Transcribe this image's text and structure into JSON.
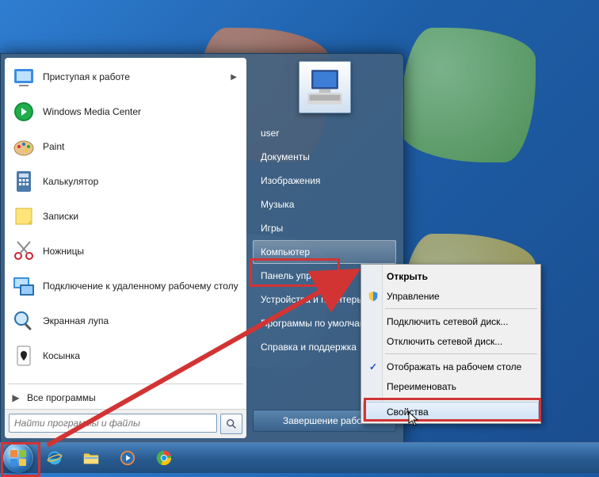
{
  "start_menu": {
    "programs": [
      {
        "label": "Приступая к работе",
        "icon_hint": "getting-started",
        "has_submenu": true
      },
      {
        "label": "Windows Media Center",
        "icon_hint": "media-center",
        "has_submenu": false
      },
      {
        "label": "Paint",
        "icon_hint": "paint",
        "has_submenu": false
      },
      {
        "label": "Калькулятор",
        "icon_hint": "calculator",
        "has_submenu": false
      },
      {
        "label": "Записки",
        "icon_hint": "sticky-notes",
        "has_submenu": false
      },
      {
        "label": "Ножницы",
        "icon_hint": "snipping-tool",
        "has_submenu": false
      },
      {
        "label": "Подключение к удаленному рабочему столу",
        "icon_hint": "remote-desktop",
        "has_submenu": false
      },
      {
        "label": "Экранная лупа",
        "icon_hint": "magnifier",
        "has_submenu": false
      },
      {
        "label": "Косынка",
        "icon_hint": "solitaire",
        "has_submenu": false
      }
    ],
    "all_programs_label": "Все программы",
    "search_placeholder": "Найти программы и файлы",
    "shutdown_label": "Завершение работ",
    "system_items": [
      "user",
      "Документы",
      "Изображения",
      "Музыка",
      "Игры",
      "Компьютер",
      "Панель управления",
      "Устройства и принтеры",
      "Программы по умолчанию",
      "Справка и поддержка"
    ],
    "highlighted_system_index": 5
  },
  "context_menu": {
    "groups": [
      [
        {
          "label": "Открыть",
          "bold": true
        },
        {
          "label": "Управление",
          "icon": "shield"
        }
      ],
      [
        {
          "label": "Подключить сетевой диск..."
        },
        {
          "label": "Отключить сетевой диск..."
        }
      ],
      [
        {
          "label": "Отображать на рабочем столе",
          "icon": "check"
        },
        {
          "label": "Переименовать"
        }
      ],
      [
        {
          "label": "Свойства",
          "highlighted": true
        }
      ]
    ]
  },
  "taskbar": {
    "items": [
      "ie",
      "explorer",
      "wmp",
      "chrome"
    ]
  }
}
